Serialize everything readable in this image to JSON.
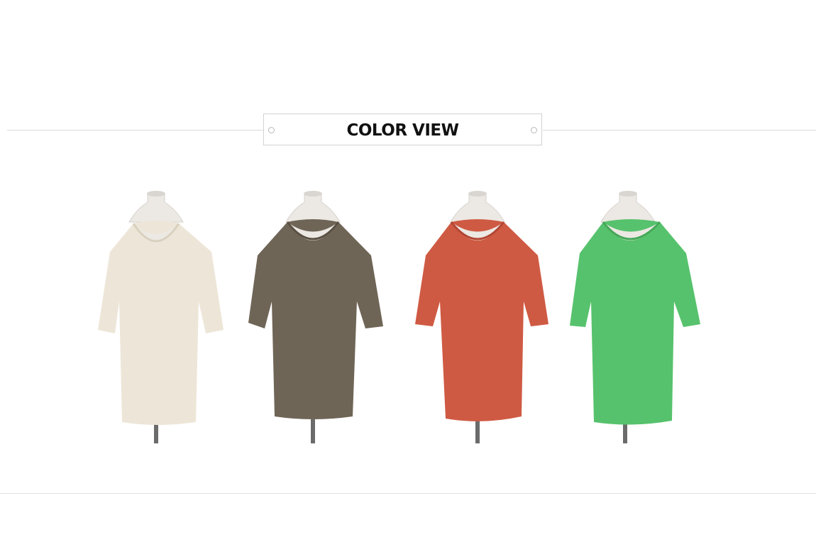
{
  "header": {
    "title": "COLOR VIEW"
  },
  "products": [
    {
      "color": "#ede6d8",
      "shade": "#d9d0bd"
    },
    {
      "color": "#6f6557",
      "shade": "#5a5144"
    },
    {
      "color": "#cf5a43",
      "shade": "#b24634"
    },
    {
      "color": "#57c26d",
      "shade": "#45a859"
    }
  ]
}
